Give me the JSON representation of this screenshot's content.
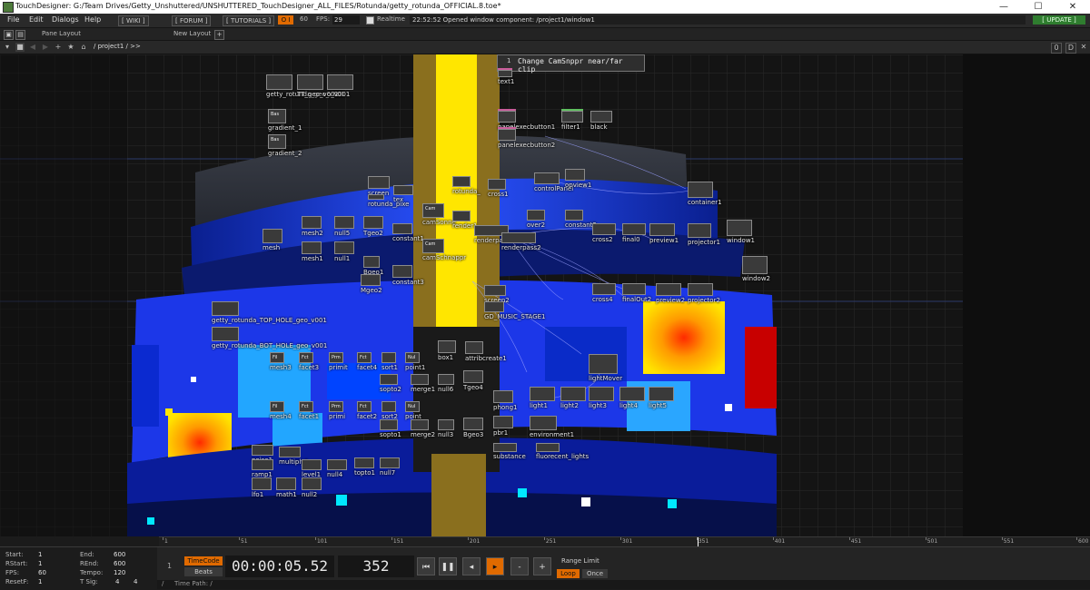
{
  "window": {
    "title": "TouchDesigner: G:/Team Drives/Getty_Unshuttered/UNSHUTTERED_TouchDesigner_ALL_FILES/Rotunda/getty_rotunda_OFFICIAL.8.toe*",
    "minimize": "—",
    "maximize": "☐",
    "close": "✕"
  },
  "menubar": {
    "items": [
      "File",
      "Edit",
      "Dialogs",
      "Help"
    ],
    "wiki": "[ WIKI ]",
    "forum": "[ FORUM ]",
    "tutorials": "[ TUTORIALS ]",
    "perf_toggle": "O I",
    "fps_target": "60",
    "fps_label": "FPS:",
    "fps_value": "29",
    "realtime_label": "Realtime",
    "status_message": "22:52:52 Opened window component: /project1/window1",
    "update": "[ UPDATE ]"
  },
  "panebar": {
    "pane_layout": "Pane Layout",
    "new_layout": "New Layout",
    "add": "+"
  },
  "pathbar": {
    "path": "/ project1 / >>",
    "right_a": "0",
    "right_b": "D"
  },
  "network": {
    "comment_number": "1",
    "comment_text": "Change CamSnppr near/far clip",
    "nodes": [
      {
        "name": "text1"
      },
      {
        "name": "getty_rotunda_geo_v001"
      },
      {
        "name": "TT_geo_v001"
      },
      {
        "name": "o_v001"
      },
      {
        "name": "gradient_1",
        "tag": "Bas"
      },
      {
        "name": "gradient_2",
        "tag": "Bas"
      },
      {
        "name": "panelexecbutton1"
      },
      {
        "name": "panelexecbutton2"
      },
      {
        "name": "filter1"
      },
      {
        "name": "black"
      },
      {
        "name": "screen"
      },
      {
        "name": "tex"
      },
      {
        "name": "rotunda_pixe"
      },
      {
        "name": "rotunda_"
      },
      {
        "name": "cross1"
      },
      {
        "name": "controlPanel"
      },
      {
        "name": "opview1"
      },
      {
        "name": "container1"
      },
      {
        "name": "camSonne",
        "tag": "Cam"
      },
      {
        "name": "render1"
      },
      {
        "name": "over2"
      },
      {
        "name": "constant2"
      },
      {
        "name": "mesh2"
      },
      {
        "name": "null5"
      },
      {
        "name": "Tgeo2"
      },
      {
        "name": "constant1"
      },
      {
        "name": "renderpass1"
      },
      {
        "name": "renderpass2"
      },
      {
        "name": "cross2"
      },
      {
        "name": "final0"
      },
      {
        "name": "preview1"
      },
      {
        "name": "projector1"
      },
      {
        "name": "window1"
      },
      {
        "name": "mesh"
      },
      {
        "name": "camSchnappr",
        "tag": "Cam"
      },
      {
        "name": "mesh1"
      },
      {
        "name": "null1"
      },
      {
        "name": "Bgeo1"
      },
      {
        "name": "window2"
      },
      {
        "name": "Mgeo2"
      },
      {
        "name": "constant3"
      },
      {
        "name": "screen2"
      },
      {
        "name": "cross4"
      },
      {
        "name": "finalOut2"
      },
      {
        "name": "preview2"
      },
      {
        "name": "projector2"
      },
      {
        "name": "getty_rotunda_TOP_HOLE_geo_v001"
      },
      {
        "name": "GD_MUSIC_STAGE1"
      },
      {
        "name": "getty_rotunda_BOT_HOLE_geo_v001"
      },
      {
        "name": "mesh3",
        "tag": "Fil"
      },
      {
        "name": "facet3",
        "tag": "Fct"
      },
      {
        "name": "primit",
        "tag": "Prm"
      },
      {
        "name": "facet4",
        "tag": "Fct"
      },
      {
        "name": "sort1"
      },
      {
        "name": "point1",
        "tag": "Nul"
      },
      {
        "name": "box1"
      },
      {
        "name": "attribcreate1"
      },
      {
        "name": "lightMover"
      },
      {
        "name": "sopto2"
      },
      {
        "name": "merge1"
      },
      {
        "name": "null6"
      },
      {
        "name": "Tgeo4"
      },
      {
        "name": "phong1"
      },
      {
        "name": "light1"
      },
      {
        "name": "light2"
      },
      {
        "name": "light3"
      },
      {
        "name": "light4"
      },
      {
        "name": "light5"
      },
      {
        "name": "mesh4",
        "tag": "Fil"
      },
      {
        "name": "facet1",
        "tag": "Fct"
      },
      {
        "name": "primi",
        "tag": "Prm"
      },
      {
        "name": "facet2",
        "tag": "Fct"
      },
      {
        "name": "sort2"
      },
      {
        "name": "point",
        "tag": "Nul"
      },
      {
        "name": "sopto1"
      },
      {
        "name": "merge2"
      },
      {
        "name": "null3"
      },
      {
        "name": "Bgeo3"
      },
      {
        "name": "pbr1"
      },
      {
        "name": "environment1"
      },
      {
        "name": "substance"
      },
      {
        "name": "fluorecent_lights"
      },
      {
        "name": "noise1"
      },
      {
        "name": "multiply1"
      },
      {
        "name": "ramp1"
      },
      {
        "name": "level1"
      },
      {
        "name": "null4"
      },
      {
        "name": "topto1"
      },
      {
        "name": "null7"
      },
      {
        "name": "lfo1"
      },
      {
        "name": "math1"
      },
      {
        "name": "null2"
      }
    ]
  },
  "timeline": {
    "ticks": [
      "1",
      "51",
      "101",
      "151",
      "201",
      "251",
      "301",
      "351",
      "401",
      "451",
      "501",
      "551",
      "600"
    ]
  },
  "info": {
    "start_label": "Start:",
    "start": "1",
    "end_label": "End:",
    "end": "600",
    "rstart_label": "RStart:",
    "rstart": "1",
    "rend_label": "REnd:",
    "rend": "600",
    "fps_label": "FPS:",
    "fps": "60",
    "tempo_label": "Tempo:",
    "tempo": "120",
    "resetf_label": "ResetF:",
    "resetf": "1",
    "tsig_label": "T Sig:",
    "tsig_a": "4",
    "tsig_b": "4"
  },
  "transport": {
    "one": "1",
    "timecode": "TimeCode",
    "beats": "Beats",
    "time": "00:00:05.52",
    "frame": "352",
    "range_limit": "Range Limit",
    "loop": "Loop",
    "once": "Once",
    "rewind": "⏮",
    "pause": "❚❚",
    "back": "◂",
    "play": "▸",
    "minus": "-",
    "plus": "+"
  },
  "timepath": {
    "label": "Time Path: /"
  },
  "colors": {
    "accent": "#e06a00",
    "update_green": "#2f7d2f",
    "blue_screen": "#1e3cff",
    "yellow": "#ffe600",
    "cyan": "#00e8ff"
  }
}
